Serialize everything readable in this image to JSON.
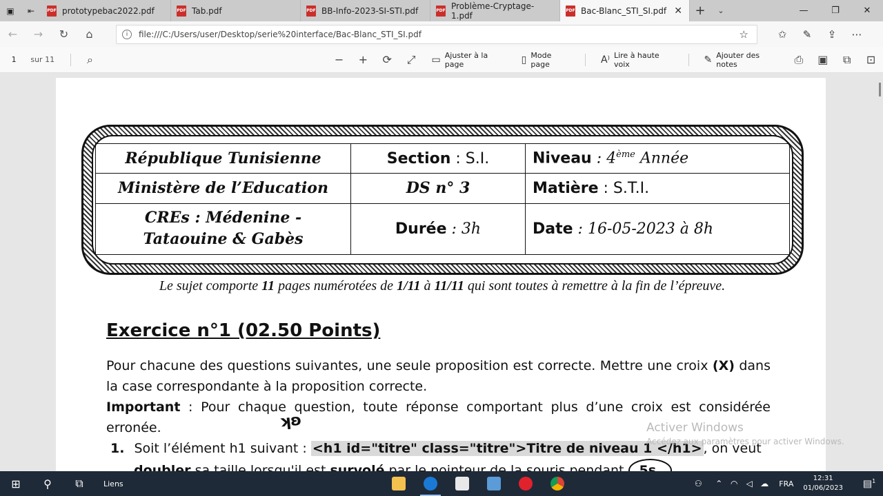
{
  "tabs": [
    {
      "label": "prototypebac2022.pdf",
      "active": false
    },
    {
      "label": "Tab.pdf",
      "active": false
    },
    {
      "label": "BB-Info-2023-SI-STI.pdf",
      "active": false
    },
    {
      "label": "Problème-Cryptage-1.pdf",
      "active": false
    },
    {
      "label": "Bac-Blanc_STI_SI.pdf",
      "active": true
    }
  ],
  "address": {
    "url": "file:///C:/Users/user/Desktop/serie%20interface/Bac-Blanc_STI_SI.pdf"
  },
  "pdf_toolbar": {
    "page_number": "1",
    "page_total": "sur 11",
    "fit_page": "Ajuster à la page",
    "page_mode": "Mode page",
    "read_aloud": "Lire à haute voix",
    "add_notes": "Ajouter des notes"
  },
  "header_table": {
    "r1": {
      "c1": "République Tunisienne",
      "c2_label": "Section",
      "c2_value": " : S.I.",
      "c3_label": "Niveau",
      "c3_value": " : 4",
      "c3_sup": "ème",
      "c3_tail": " Année"
    },
    "r2": {
      "c1": "Ministère de l’Education",
      "c2": "DS n° 3",
      "c3_label": "Matière",
      "c3_value": " : S.T.I."
    },
    "r3": {
      "c1_a": "CREs : Médenine -",
      "c1_b": "Tataouine & Gabès",
      "c2_label": "Durée",
      "c2_value": " : 3h",
      "c3_label": "Date",
      "c3_value": " : 16-05-2023 à 8h"
    }
  },
  "document": {
    "subtitle_a": "Le sujet comporte ",
    "subtitle_pages": "11",
    "subtitle_b": " pages numérotées de ",
    "subtitle_from": "1/11",
    "subtitle_c": " à ",
    "subtitle_to": "11/11",
    "subtitle_d": " qui sont toutes à remettre à la fin de l’épreuve.",
    "exercise_title": "Exercice n°1 (02.50 Points)",
    "para1_a": "Pour chacune des questions suivantes, une seule proposition est correcte. Mettre une croix ",
    "para1_x": "(X)",
    "para1_b": " dans la case correspondante à la proposition correcte.",
    "para2_label": "Important",
    "para2_text": " : Pour chaque question, toute réponse comportant plus d’une croix est considérée erronée.",
    "q1_num": "1.",
    "q1_a": "Soit l’élément h1 suivant : ",
    "q1_code": "<h1 id=\"titre\" class=\"titre\">Titre de niveau 1 </h1>",
    "q1_b": ", on veut ",
    "q1_bold1": "doubler",
    "q1_c": " sa taille lorsqu'il est ",
    "q1_bold2": "survolé",
    "q1_d": " par le pointeur de la souris pendant ",
    "q1_circle": "5s."
  },
  "watermark": {
    "line1": "Activer Windows",
    "line2": "Accédez aux paramètres pour activer Windows."
  },
  "taskbar": {
    "links_label": "Liens",
    "language": "FRA",
    "time": "12:31",
    "date": "01/06/2023",
    "notification_count": "1"
  }
}
